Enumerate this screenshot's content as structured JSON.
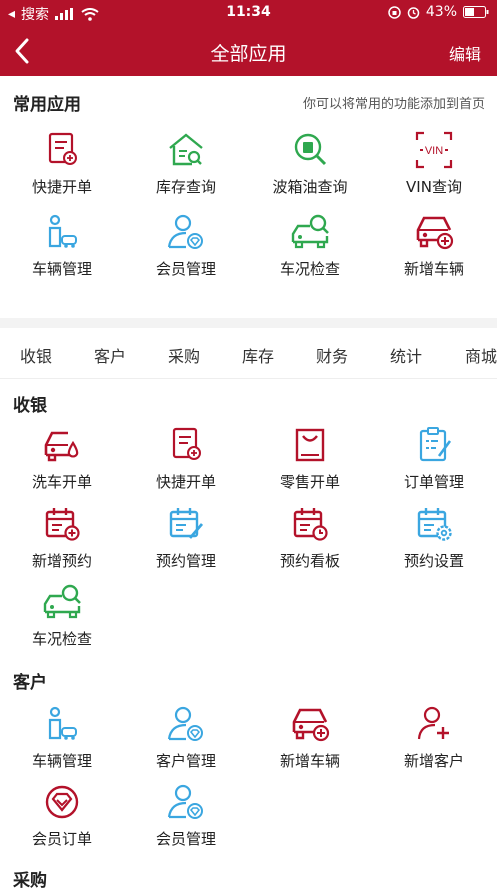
{
  "status_bar": {
    "carrier": "搜索",
    "time": "11:34",
    "battery": "43%"
  },
  "nav": {
    "title": "全部应用",
    "edit": "编辑"
  },
  "common": {
    "title": "常用应用",
    "hint": "你可以将常用的功能添加到首页",
    "items": [
      {
        "label": "快捷开单",
        "icon": "quick-order-icon"
      },
      {
        "label": "库存查询",
        "icon": "inventory-query-icon"
      },
      {
        "label": "波箱油查询",
        "icon": "gearbox-oil-query-icon"
      },
      {
        "label": "VIN查询",
        "icon": "vin-query-icon"
      },
      {
        "label": "车辆管理",
        "icon": "vehicle-management-icon"
      },
      {
        "label": "会员管理",
        "icon": "member-management-icon"
      },
      {
        "label": "车况检查",
        "icon": "vehicle-inspection-icon"
      },
      {
        "label": "新增车辆",
        "icon": "add-vehicle-icon"
      }
    ]
  },
  "tabs": [
    "收银",
    "客户",
    "采购",
    "库存",
    "财务",
    "统计",
    "商城"
  ],
  "cashier": {
    "title": "收银",
    "items": [
      {
        "label": "洗车开单",
        "icon": "car-wash-order-icon"
      },
      {
        "label": "快捷开单",
        "icon": "quick-order-icon"
      },
      {
        "label": "零售开单",
        "icon": "retail-order-icon"
      },
      {
        "label": "订单管理",
        "icon": "order-management-icon"
      },
      {
        "label": "新增预约",
        "icon": "add-appointment-icon"
      },
      {
        "label": "预约管理",
        "icon": "appointment-management-icon"
      },
      {
        "label": "预约看板",
        "icon": "appointment-board-icon"
      },
      {
        "label": "预约设置",
        "icon": "appointment-settings-icon"
      },
      {
        "label": "车况检查",
        "icon": "vehicle-inspection-icon"
      }
    ]
  },
  "customer": {
    "title": "客户",
    "items": [
      {
        "label": "车辆管理",
        "icon": "vehicle-management-icon"
      },
      {
        "label": "客户管理",
        "icon": "customer-management-icon"
      },
      {
        "label": "新增车辆",
        "icon": "add-vehicle-icon"
      },
      {
        "label": "新增客户",
        "icon": "add-customer-icon"
      },
      {
        "label": "会员订单",
        "icon": "member-order-icon"
      },
      {
        "label": "会员管理",
        "icon": "member-management-icon"
      }
    ]
  },
  "purchase": {
    "title": "采购"
  },
  "colors": {
    "brand_red": "#b3122a",
    "green": "#2fa84f",
    "blue": "#3aa6e0"
  }
}
